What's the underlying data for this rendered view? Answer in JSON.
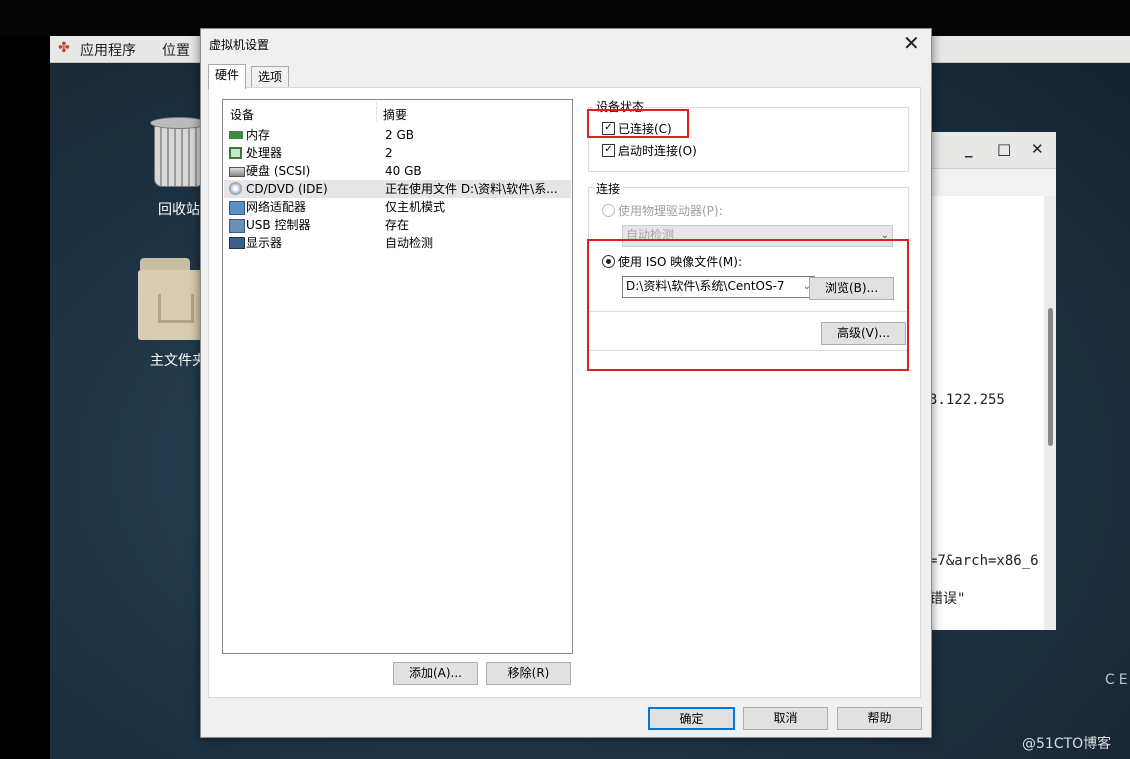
{
  "taskbar": {
    "apps_label": "应用程序",
    "places_label": "位置"
  },
  "desktop": {
    "trash_label": "回收站",
    "home_label": "主文件夹",
    "corner_text": "CE"
  },
  "terminal": {
    "line1": "3.122.255",
    "line2": "=7&arch=x86_6",
    "line3": "错误\""
  },
  "dialog": {
    "title": "虚拟机设置",
    "tabs": [
      "硬件",
      "选项"
    ],
    "list_headers": {
      "device": "设备",
      "summary": "摘要"
    },
    "devices": [
      {
        "name": "内存",
        "summary": "2 GB",
        "icon": "memory-icon"
      },
      {
        "name": "处理器",
        "summary": "2",
        "icon": "cpu-icon"
      },
      {
        "name": "硬盘 (SCSI)",
        "summary": "40 GB",
        "icon": "harddisk-icon"
      },
      {
        "name": "CD/DVD (IDE)",
        "summary": "正在使用文件 D:\\资料\\软件\\系...",
        "icon": "cd-icon"
      },
      {
        "name": "网络适配器",
        "summary": "仅主机模式",
        "icon": "network-icon"
      },
      {
        "name": "USB 控制器",
        "summary": "存在",
        "icon": "usb-icon"
      },
      {
        "name": "显示器",
        "summary": "自动检测",
        "icon": "monitor-icon"
      }
    ],
    "add_button": "添加(A)...",
    "remove_button": "移除(R)",
    "device_status": {
      "group_label": "设备状态",
      "connected_label": "已连接(C)",
      "connected_checked": true,
      "connect_at_power_on_label": "启动时连接(O)",
      "connect_at_power_on_checked": true
    },
    "connection": {
      "group_label": "连接",
      "physical_drive_label": "使用物理驱动器(P):",
      "physical_drive_value": "自动检测",
      "iso_label": "使用 ISO 映像文件(M):",
      "iso_path": "D:\\资料\\软件\\系统\\CentOS-7",
      "browse_button": "浏览(B)...",
      "advanced_button": "高级(V)..."
    },
    "ok_button": "确定",
    "cancel_button": "取消",
    "help_button": "帮助"
  },
  "watermark": "@51CTO博客",
  "colors": {
    "highlight": "#e0201e",
    "focus_border": "#0078d7"
  }
}
